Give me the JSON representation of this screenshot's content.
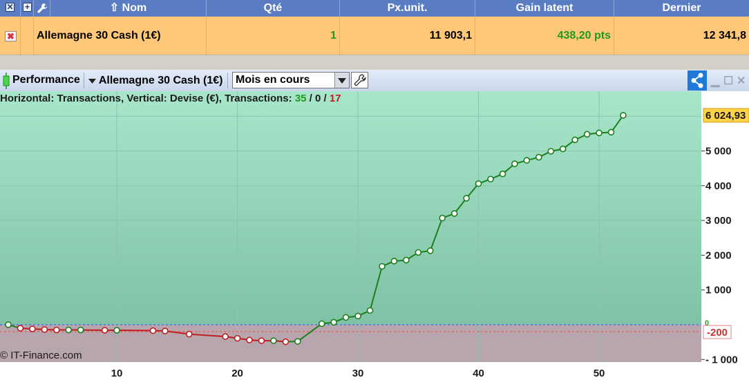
{
  "table": {
    "headers": {
      "nom": "Nom",
      "qte": "Qté",
      "px_unit": "Px.unit.",
      "gain_latent": "Gain latent",
      "dernier": "Dernier"
    },
    "row": {
      "nom": "Allemagne 30 Cash (1€)",
      "qte": "1",
      "px_unit": "11 903,1",
      "gain_latent": "438,20 pts",
      "dernier": "12 341,8"
    },
    "colors": {
      "gain": "#1f9a1f",
      "row_bg": "#ffc878",
      "header_bg": "#5a7cc2"
    }
  },
  "toolbar": {
    "performance_label": "Performance",
    "instrument_label": "Allemagne 30 Cash (1€)",
    "period_value": "Mois en cours"
  },
  "chart_caption": {
    "prefix": "Horizontal: Transactions, Vertical: Devise (€), Transactions:",
    "win_count": "35",
    "slash1": " / ",
    "neutral_count": "0",
    "slash2": " / ",
    "loss_count": "17"
  },
  "copyright": "© IT-Finance.com",
  "chart_data": {
    "type": "line",
    "x": [
      1,
      2,
      3,
      4,
      5,
      6,
      7,
      9,
      10,
      13,
      14,
      16,
      19,
      20,
      21,
      22,
      23,
      24,
      25,
      27,
      28,
      29,
      30,
      31,
      32,
      33,
      34,
      35,
      36,
      37,
      38,
      39,
      40,
      41,
      42,
      43,
      44,
      45,
      46,
      47,
      48,
      49,
      50,
      51,
      52
    ],
    "y": [
      0,
      -100,
      -120,
      -140,
      -150,
      -150,
      -150,
      -160,
      -160,
      -170,
      -180,
      -270,
      -340,
      -390,
      -440,
      -460,
      -460,
      -490,
      -480,
      30,
      70,
      210,
      250,
      410,
      1680,
      1830,
      1860,
      2080,
      2130,
      3070,
      3200,
      3640,
      4060,
      4190,
      4340,
      4630,
      4730,
      4820,
      4990,
      5060,
      5320,
      5480,
      5520,
      5540,
      6024.93
    ],
    "xlim": [
      0,
      58
    ],
    "ylim": [
      -1100,
      6600
    ],
    "x_ticks": [
      "10",
      "20",
      "30",
      "40",
      "50"
    ],
    "y_ticks": [
      "6 024,93",
      "5 000",
      "4 000",
      "3 000",
      "2 000",
      "1 000",
      "0",
      "-200",
      "- 1 000"
    ],
    "last_value_label": "6 024,93",
    "zero_label": "0",
    "threshold_label": "-200",
    "threshold_value": -200,
    "grid": true,
    "colors": {
      "gain_line": "#1b7f1b",
      "loss_line": "#bf1e1e",
      "bg_top": "#a8e6ca",
      "bg_bottom": "#78bca0",
      "below_zero_bg": "#b8a6ae",
      "zero_line": "#2f56d8",
      "threshold_line": "#e05050"
    }
  }
}
